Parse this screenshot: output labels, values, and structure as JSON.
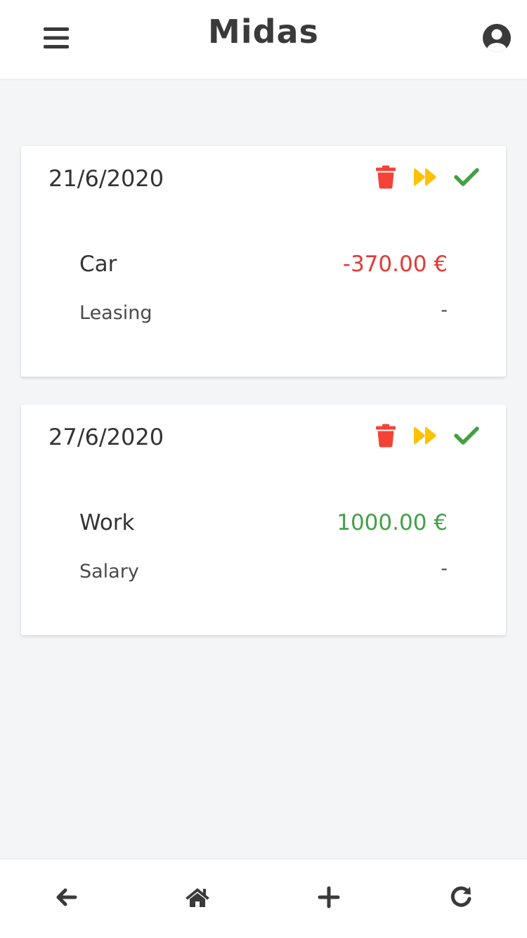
{
  "app": {
    "title": "Midas"
  },
  "header": {
    "menu_icon": "hamburger-menu-icon",
    "account_icon": "user-circle-icon"
  },
  "colors": {
    "expense": "#e53935",
    "income": "#43a047",
    "delete": "#f44336",
    "skip": "#ffc107",
    "done": "#43a047",
    "text": "#333333"
  },
  "entries": [
    {
      "date": "21/6/2020",
      "category": "Car",
      "amount": "-370.00 €",
      "type": "expense",
      "description": "Leasing",
      "note": "-"
    },
    {
      "date": "27/6/2020",
      "category": "Work",
      "amount": "1000.00 €",
      "type": "income",
      "description": "Salary",
      "note": "-"
    }
  ],
  "card_actions": {
    "delete_icon": "trash-icon",
    "skip_icon": "fast-forward-icon",
    "done_icon": "checkmark-icon"
  },
  "bottom_nav": {
    "items": [
      {
        "icon": "arrow-left-icon"
      },
      {
        "icon": "home-icon"
      },
      {
        "icon": "plus-icon"
      },
      {
        "icon": "refresh-icon"
      }
    ]
  }
}
